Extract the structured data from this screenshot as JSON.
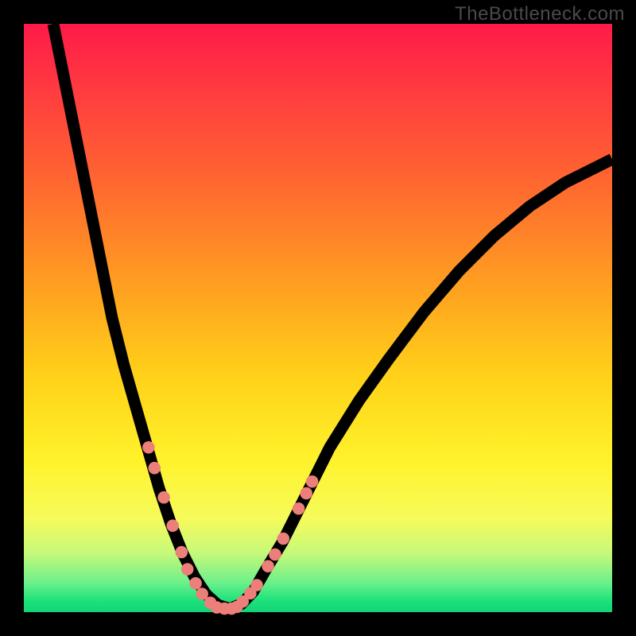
{
  "watermark": "TheBottleneck.com",
  "chart_data": {
    "type": "line",
    "title": "",
    "xlabel": "",
    "ylabel": "",
    "xlim": [
      0,
      100
    ],
    "ylim": [
      0,
      100
    ],
    "curve_left": {
      "comment": "left branch of V-shaped bottleneck curve (x,y pairs, y=0 is bottom)",
      "points": [
        [
          5,
          100
        ],
        [
          7,
          90
        ],
        [
          9,
          80
        ],
        [
          11,
          70
        ],
        [
          13,
          60
        ],
        [
          15,
          50
        ],
        [
          17,
          42
        ],
        [
          19,
          35
        ],
        [
          21,
          28
        ],
        [
          23,
          21
        ],
        [
          25,
          15
        ],
        [
          27,
          10
        ],
        [
          29,
          6
        ],
        [
          31,
          3
        ],
        [
          33,
          1.2
        ],
        [
          35,
          0.6
        ]
      ]
    },
    "curve_right": {
      "comment": "right branch, asymptotic flattening to the upper right",
      "points": [
        [
          35,
          0.6
        ],
        [
          37,
          1.4
        ],
        [
          39,
          3.5
        ],
        [
          41,
          7
        ],
        [
          44,
          12
        ],
        [
          48,
          20
        ],
        [
          52,
          28
        ],
        [
          57,
          36
        ],
        [
          62,
          43
        ],
        [
          68,
          51
        ],
        [
          74,
          58
        ],
        [
          80,
          64
        ],
        [
          86,
          69
        ],
        [
          92,
          73
        ],
        [
          98,
          76
        ],
        [
          100,
          77
        ]
      ]
    },
    "dots_left": {
      "comment": "pink sample dots on the left branch (lower portion)",
      "points": [
        [
          21.2,
          28
        ],
        [
          22.2,
          24.5
        ],
        [
          23.8,
          19.5
        ],
        [
          25.3,
          14.7
        ],
        [
          26.8,
          10.2
        ],
        [
          27.8,
          7.3
        ],
        [
          29.2,
          4.9
        ],
        [
          30.3,
          3.1
        ],
        [
          31.7,
          1.6
        ]
      ]
    },
    "dots_right": {
      "comment": "pink sample dots on the right branch (lower portion)",
      "points": [
        [
          37.2,
          1.8
        ],
        [
          38.5,
          3.2
        ],
        [
          39.6,
          4.6
        ],
        [
          41.5,
          7.8
        ],
        [
          42.7,
          9.8
        ],
        [
          44.1,
          12.5
        ],
        [
          46.7,
          17.6
        ],
        [
          48.0,
          20.2
        ],
        [
          49.0,
          22.2
        ]
      ]
    },
    "dots_bottom": {
      "comment": "flat cluster of pink dots at the valley floor",
      "points": [
        [
          32.8,
          0.8
        ],
        [
          34.1,
          0.6
        ],
        [
          35.3,
          0.6
        ],
        [
          36.2,
          0.9
        ]
      ]
    },
    "colors": {
      "curve": "#000000",
      "dot": "#ec7f7a",
      "frame": "#000000"
    }
  }
}
